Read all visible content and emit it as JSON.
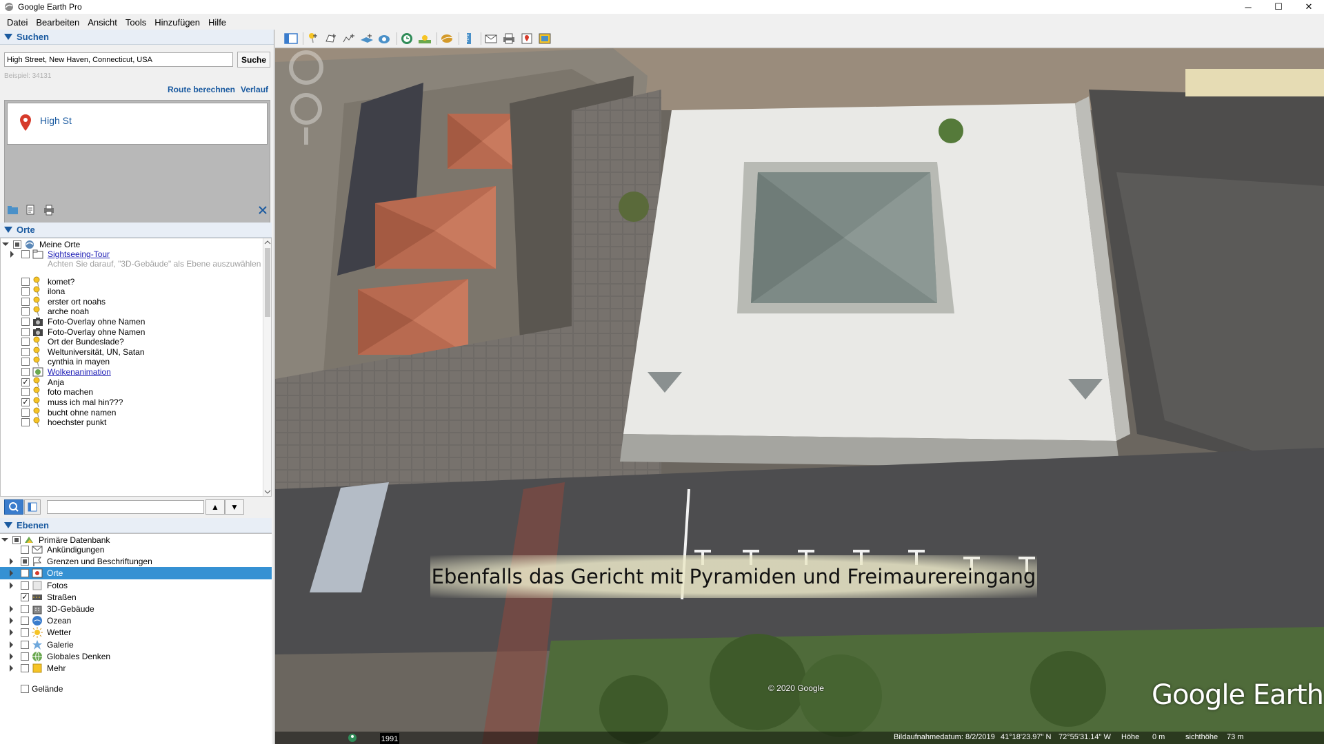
{
  "window": {
    "title": "Google Earth Pro",
    "minimize": "─",
    "maximize": "☐",
    "close": "✕"
  },
  "menu": [
    "Datei",
    "Bearbeiten",
    "Ansicht",
    "Tools",
    "Hinzufügen",
    "Hilfe"
  ],
  "search": {
    "header": "Suchen",
    "query": "High Street, New Haven, Connecticut, USA",
    "button": "Suche",
    "hint": "Beispiel: 34131",
    "route_link": "Route berechnen",
    "history_link": "Verlauf",
    "results": [
      {
        "title": "High St"
      }
    ]
  },
  "places": {
    "header": "Orte",
    "root": {
      "label": "Meine Orte",
      "checked": "partial",
      "expanded": true
    },
    "items": [
      {
        "label": "Sightseeing-Tour",
        "icon": "folder-icon",
        "checked": false,
        "link": true,
        "expandable": true
      },
      {
        "label": "Achten Sie darauf, \"3D-Gebäude\" als Ebene auszuwählen",
        "icon": "",
        "checked": null,
        "dim": true
      },
      {
        "label": "komet?",
        "icon": "pushpin-icon",
        "checked": false
      },
      {
        "label": "ilona",
        "icon": "pushpin-icon",
        "checked": false
      },
      {
        "label": "erster ort noahs",
        "icon": "pushpin-icon",
        "checked": false
      },
      {
        "label": "arche noah",
        "icon": "pushpin-icon",
        "checked": false
      },
      {
        "label": "Foto-Overlay ohne Namen",
        "icon": "camera-icon",
        "checked": false
      },
      {
        "label": "Foto-Overlay ohne Namen",
        "icon": "camera-icon",
        "checked": false
      },
      {
        "label": "Ort der Bundeslade?",
        "icon": "pushpin-icon",
        "checked": false
      },
      {
        "label": "Weltuniversität, UN, Satan",
        "icon": "pushpin-icon",
        "checked": false
      },
      {
        "label": "cynthia in mayen",
        "icon": "pushpin-icon",
        "checked": false
      },
      {
        "label": "Wolkenanimation",
        "icon": "network-link-icon",
        "checked": false,
        "link": true
      },
      {
        "label": "Anja",
        "icon": "pushpin-icon",
        "checked": true
      },
      {
        "label": "foto machen",
        "icon": "pushpin-icon",
        "checked": false
      },
      {
        "label": "muss ich mal hin???",
        "icon": "pushpin-icon",
        "checked": true
      },
      {
        "label": "bucht ohne namen",
        "icon": "pushpin-icon",
        "checked": false
      },
      {
        "label": "hoechster punkt",
        "icon": "pushpin-icon",
        "checked": false
      }
    ],
    "move_up": "▲",
    "move_down": "▼"
  },
  "layers": {
    "header": "Ebenen",
    "root": {
      "label": "Primäre Datenbank",
      "checked": "partial"
    },
    "items": [
      {
        "label": "Ankündigungen",
        "icon": "envelope-icon",
        "checked": false,
        "expandable": false
      },
      {
        "label": "Grenzen und Beschriftungen",
        "icon": "flag-icon",
        "checked": "partial",
        "expandable": true
      },
      {
        "label": "Orte",
        "icon": "places-icon",
        "checked": true,
        "expandable": true,
        "selected": true
      },
      {
        "label": "Fotos",
        "icon": "photo-icon",
        "checked": false,
        "expandable": true
      },
      {
        "label": "Straßen",
        "icon": "road-icon",
        "checked": true,
        "expandable": false
      },
      {
        "label": "3D-Gebäude",
        "icon": "building-icon",
        "checked": false,
        "expandable": true
      },
      {
        "label": "Ozean",
        "icon": "ocean-icon",
        "checked": false,
        "expandable": true
      },
      {
        "label": "Wetter",
        "icon": "weather-icon",
        "checked": false,
        "expandable": true
      },
      {
        "label": "Galerie",
        "icon": "gallery-icon",
        "checked": false,
        "expandable": true
      },
      {
        "label": "Globales Denken",
        "icon": "globe-icon",
        "checked": false,
        "expandable": true
      },
      {
        "label": "Mehr",
        "icon": "more-icon",
        "checked": false,
        "expandable": true
      }
    ],
    "terrain": {
      "label": "Gelände",
      "checked": false
    }
  },
  "map": {
    "caption": "Ebenfalls das Gericht mit Pyramiden und Freimaurereingang",
    "copyright": "© 2020 Google",
    "logo": "Google Earth",
    "year": "1991",
    "status": {
      "imagery_date": "Bildaufnahmedatum: 8/2/2019",
      "lat": "41°18'23.97\" N",
      "lon": "72°55'31.14\" W",
      "elev_label": "Höhe",
      "elev": "0 m",
      "eye_label": "sichthöhe",
      "eye": "73 m"
    }
  },
  "colors": {
    "accent": "#1a5aa0",
    "selection": "#3591d3",
    "link": "#1a1ab4"
  }
}
